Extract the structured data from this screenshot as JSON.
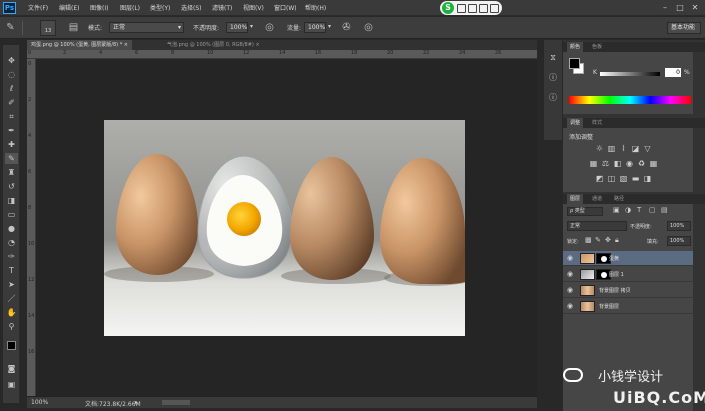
{
  "app": {
    "logo": "Ps"
  },
  "menu": [
    "文件(F)",
    "编辑(E)",
    "图像(I)",
    "图层(L)",
    "类型(Y)",
    "选择(S)",
    "滤镜(T)",
    "视图(V)",
    "窗口(W)",
    "帮助(H)"
  ],
  "ime": {
    "icon": "sogou-icon"
  },
  "window_controls": {
    "minimize": "–",
    "maximize": "□",
    "close": "✕"
  },
  "options": {
    "brush_size": "13",
    "mode_label": "模式:",
    "mode_value": "正常",
    "opacity_label": "不透明度:",
    "opacity_value": "100%",
    "flow_label": "流量:",
    "flow_value": "100%",
    "workspace": "基本功能"
  },
  "tabs": [
    {
      "label": "鸡蛋.png @ 100% (蛋黄, 图层蒙版/8) * ×",
      "active": true
    },
    {
      "label": "气泡.png @ 100% (图层 0, RGB/8#) ×",
      "active": false
    }
  ],
  "ruler": {
    "top": [
      "0",
      "2",
      "4",
      "6",
      "8",
      "10",
      "12",
      "14",
      "16",
      "18",
      "20",
      "22",
      "24",
      "26"
    ],
    "left": [
      "0",
      "2",
      "4",
      "6",
      "8",
      "10",
      "12",
      "14",
      "16"
    ]
  },
  "status": {
    "zoom": "100%",
    "doc": "文档:723.8K/2.66M"
  },
  "panels": {
    "color_tabs": [
      "颜色",
      "色板"
    ],
    "color_k_label": "K",
    "color_k_value": "0",
    "color_k_unit": "%",
    "adjust_tabs": [
      "调整",
      "样式"
    ],
    "adjust_title": "添加调整",
    "layers_tabs": [
      "图层",
      "通道",
      "路径"
    ],
    "filter_type": "ρ 类型",
    "blend_mode": "正常",
    "opacity_label": "不透明度:",
    "opacity_value": "100%",
    "lock_label": "锁定:",
    "fill_label": "填充:",
    "fill_value": "100%",
    "layers": [
      {
        "name": "蛋黄",
        "selected": true
      },
      {
        "name": "图层 1",
        "selected": false
      },
      {
        "name": "背景图层 拷贝",
        "selected": false
      },
      {
        "name": "背景图层",
        "selected": false
      }
    ]
  },
  "watermark": {
    "line1": "小钱学设计",
    "line2": "UiBQ.CoM"
  }
}
